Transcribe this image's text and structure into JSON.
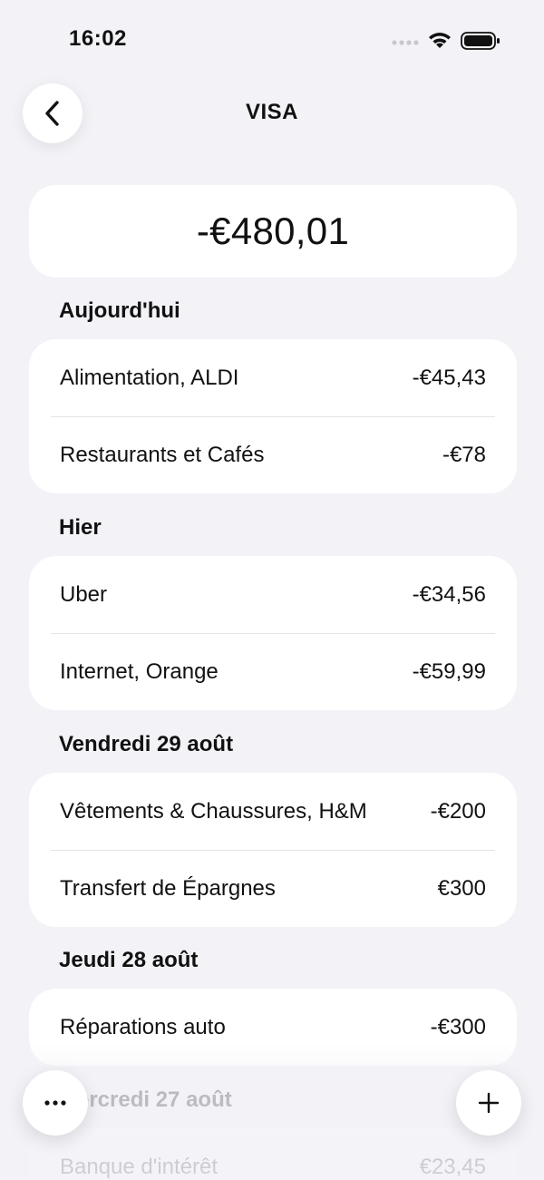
{
  "status_bar": {
    "time": "16:02",
    "icons": [
      "signal-icon",
      "wifi-icon",
      "battery-icon"
    ]
  },
  "nav": {
    "title": "VISA",
    "back_icon": "chevron-left-icon"
  },
  "balance": {
    "amount": "-€480,01"
  },
  "sections": [
    {
      "title": "Aujourd'hui",
      "rows": [
        {
          "label": "Alimentation, ALDI",
          "amount": "-€45,43"
        },
        {
          "label": "Restaurants et Cafés",
          "amount": "-€78"
        }
      ]
    },
    {
      "title": "Hier",
      "rows": [
        {
          "label": "Uber",
          "amount": "-€34,56"
        },
        {
          "label": "Internet, Orange",
          "amount": "-€59,99"
        }
      ]
    },
    {
      "title": "Vendredi 29 août",
      "rows": [
        {
          "label": "Vêtements & Chaussures, H&M",
          "amount": "-€200"
        },
        {
          "label": "Transfert de Épargnes",
          "amount": "€300"
        }
      ]
    },
    {
      "title": "Jeudi 28 août",
      "rows": [
        {
          "label": "Réparations auto",
          "amount": "-€300"
        }
      ]
    },
    {
      "title": "Mercredi 27 août",
      "rows": [
        {
          "label": "Banque d'intérêt",
          "amount": "€23,45"
        }
      ]
    }
  ],
  "actions": {
    "more_icon": "more-horizontal-icon",
    "add_icon": "plus-icon"
  },
  "colors": {
    "background": "#f2f2f7",
    "card": "#ffffff",
    "text": "#111111",
    "divider": "#e3e3e8"
  }
}
